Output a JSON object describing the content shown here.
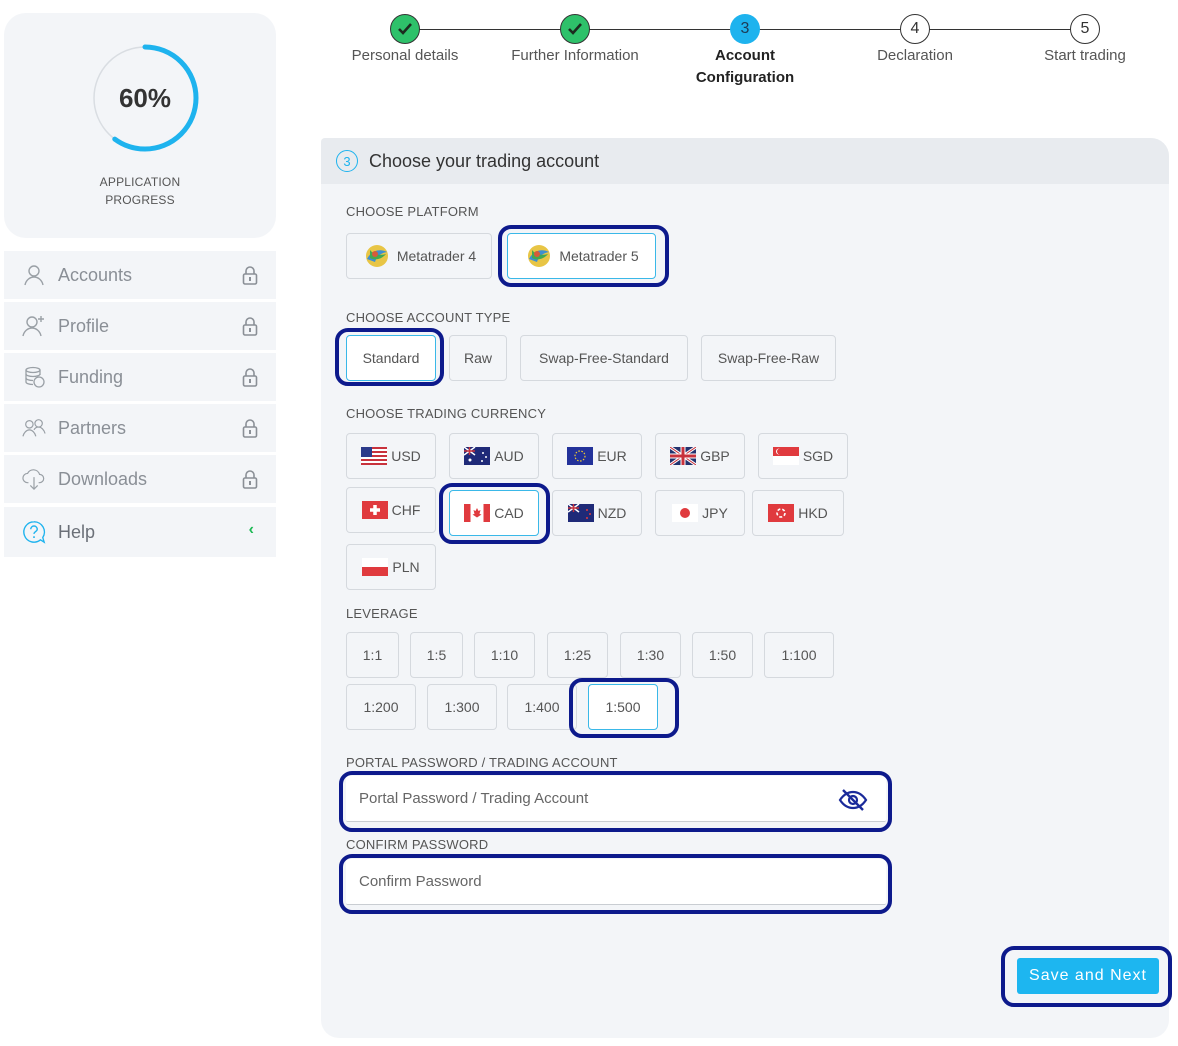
{
  "progress": {
    "percent_text": "60%",
    "percent_value": 0.6,
    "label_line1": "APPLICATION",
    "label_line2": "PROGRESS",
    "ring_color": "#1eb3ee"
  },
  "sidebar": {
    "items": [
      {
        "label": "Accounts",
        "icon": "user-icon",
        "locked": true
      },
      {
        "label": "Profile",
        "icon": "user-plus-icon",
        "locked": true
      },
      {
        "label": "Funding",
        "icon": "coins-icon",
        "locked": true
      },
      {
        "label": "Partners",
        "icon": "users-icon",
        "locked": true
      },
      {
        "label": "Downloads",
        "icon": "cloud-download-icon",
        "locked": true
      }
    ],
    "help": {
      "label": "Help",
      "icon": "help-icon",
      "chevron": "‹"
    }
  },
  "stepper": {
    "steps": [
      {
        "number": "",
        "label": "Personal details",
        "state": "done"
      },
      {
        "number": "",
        "label": "Further Information",
        "state": "done"
      },
      {
        "number": "3",
        "label_line1": "Account",
        "label_line2": "Configuration",
        "state": "current"
      },
      {
        "number": "4",
        "label": "Declaration",
        "state": "todo"
      },
      {
        "number": "5",
        "label": "Start trading",
        "state": "todo"
      }
    ]
  },
  "panel": {
    "step_number": "3",
    "title": "Choose your trading account",
    "platform": {
      "label": "CHOOSE PLATFORM",
      "options": [
        "Metatrader 4",
        "Metatrader 5"
      ],
      "selected": "Metatrader 5"
    },
    "account_type": {
      "label": "CHOOSE ACCOUNT TYPE",
      "options": [
        "Standard",
        "Raw",
        "Swap-Free-Standard",
        "Swap-Free-Raw"
      ],
      "selected": "Standard"
    },
    "currency": {
      "label": "CHOOSE TRADING CURRENCY",
      "options": [
        "USD",
        "AUD",
        "EUR",
        "GBP",
        "SGD",
        "CHF",
        "CAD",
        "NZD",
        "JPY",
        "HKD",
        "PLN"
      ],
      "selected": "CAD"
    },
    "leverage": {
      "label": "LEVERAGE",
      "options": [
        "1:1",
        "1:5",
        "1:10",
        "1:25",
        "1:30",
        "1:50",
        "1:100",
        "1:200",
        "1:300",
        "1:400",
        "1:500"
      ],
      "selected": "1:500"
    },
    "password": {
      "label": "PORTAL PASSWORD / TRADING ACCOUNT",
      "placeholder": "Portal Password / Trading Account",
      "value": ""
    },
    "confirm": {
      "label": "CONFIRM PASSWORD",
      "placeholder": "Confirm Password",
      "value": ""
    },
    "save_label": "Save and Next"
  },
  "colors": {
    "accent": "#1eb3ee",
    "done": "#2ec16a",
    "highlight": "#0d1a8c"
  }
}
